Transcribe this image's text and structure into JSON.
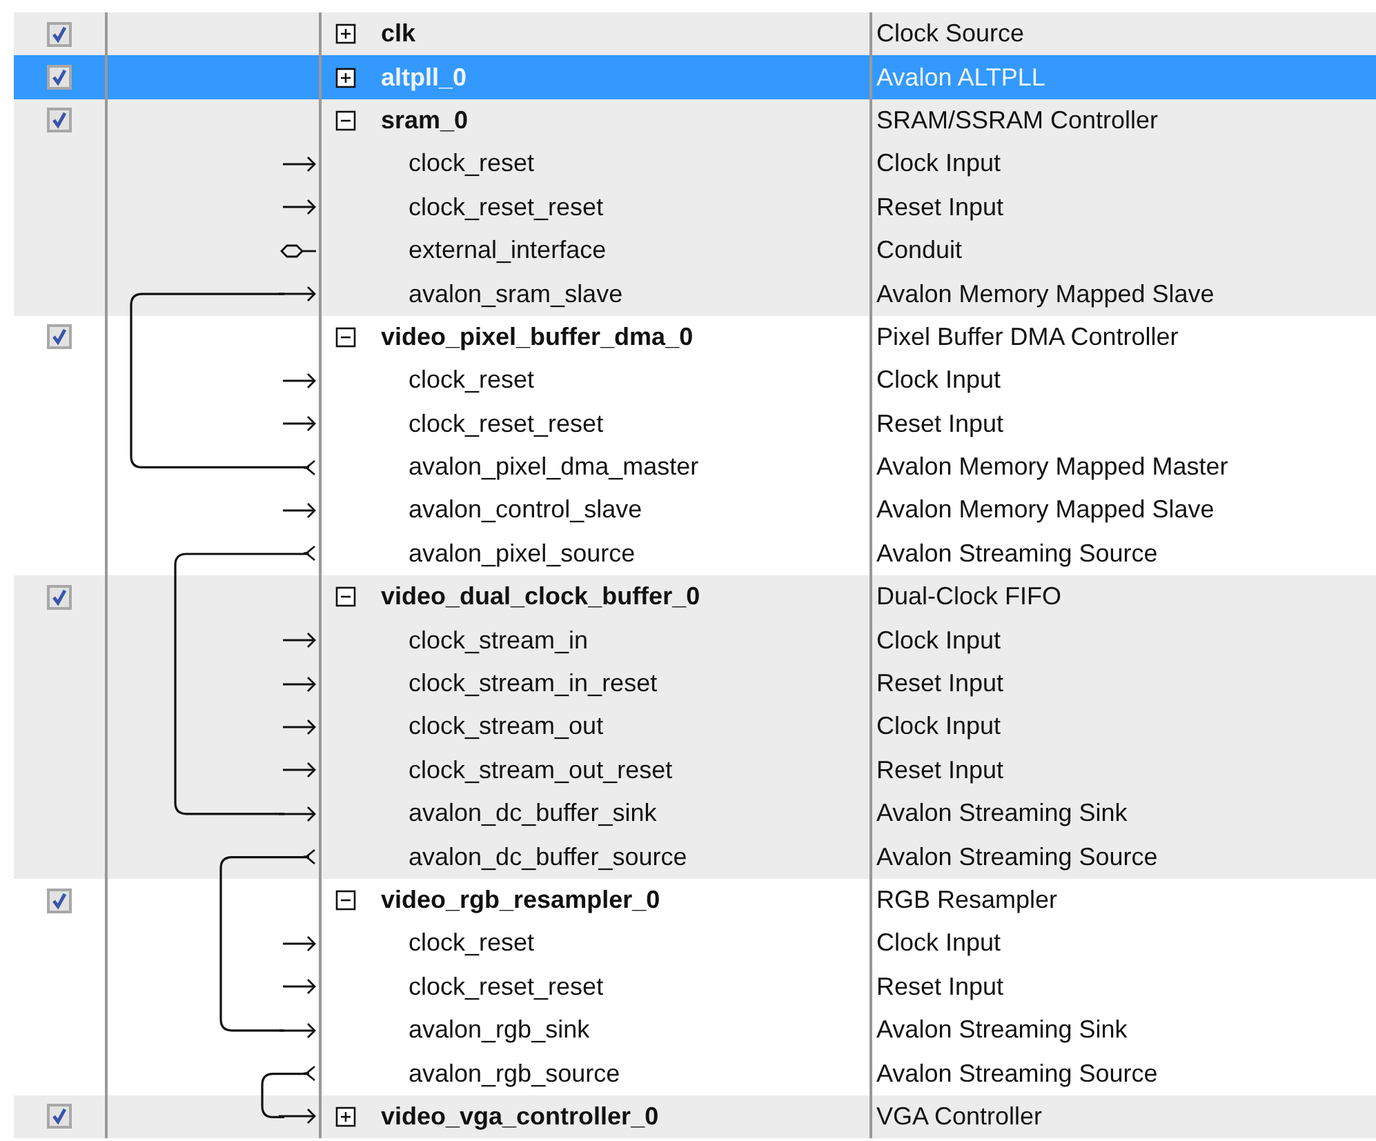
{
  "modules": [
    {
      "name": "clk",
      "description": "Clock Source",
      "checked": true,
      "expanded": false,
      "selected": false
    },
    {
      "name": "altpll_0",
      "description": "Avalon ALTPLL",
      "checked": true,
      "expanded": false,
      "selected": true
    },
    {
      "name": "sram_0",
      "description": "SRAM/SSRAM Controller",
      "checked": true,
      "expanded": true,
      "selected": false,
      "children": [
        {
          "name": "clock_reset",
          "description": "Clock Input",
          "kind": "in",
          "connected": false
        },
        {
          "name": "clock_reset_reset",
          "description": "Reset Input",
          "kind": "in",
          "connected": false
        },
        {
          "name": "external_interface",
          "description": "Conduit",
          "kind": "conduit",
          "connected": false
        },
        {
          "name": "avalon_sram_slave",
          "description": "Avalon Memory Mapped Slave",
          "kind": "in",
          "connected": true
        }
      ]
    },
    {
      "name": "video_pixel_buffer_dma_0",
      "description": "Pixel Buffer DMA Controller",
      "checked": true,
      "expanded": true,
      "selected": false,
      "children": [
        {
          "name": "clock_reset",
          "description": "Clock Input",
          "kind": "in",
          "connected": false
        },
        {
          "name": "clock_reset_reset",
          "description": "Reset Input",
          "kind": "in",
          "connected": false
        },
        {
          "name": "avalon_pixel_dma_master",
          "description": "Avalon Memory Mapped Master",
          "kind": "out",
          "connected": true
        },
        {
          "name": "avalon_control_slave",
          "description": "Avalon Memory Mapped Slave",
          "kind": "in",
          "connected": false
        },
        {
          "name": "avalon_pixel_source",
          "description": "Avalon Streaming Source",
          "kind": "out",
          "connected": true
        }
      ]
    },
    {
      "name": "video_dual_clock_buffer_0",
      "description": "Dual-Clock FIFO",
      "checked": true,
      "expanded": true,
      "selected": false,
      "children": [
        {
          "name": "clock_stream_in",
          "description": "Clock Input",
          "kind": "in",
          "connected": false
        },
        {
          "name": "clock_stream_in_reset",
          "description": "Reset Input",
          "kind": "in",
          "connected": false
        },
        {
          "name": "clock_stream_out",
          "description": "Clock Input",
          "kind": "in",
          "connected": false
        },
        {
          "name": "clock_stream_out_reset",
          "description": "Reset Input",
          "kind": "in",
          "connected": false
        },
        {
          "name": "avalon_dc_buffer_sink",
          "description": "Avalon Streaming Sink",
          "kind": "in",
          "connected": true
        },
        {
          "name": "avalon_dc_buffer_source",
          "description": "Avalon Streaming Source",
          "kind": "out",
          "connected": true
        }
      ]
    },
    {
      "name": "video_rgb_resampler_0",
      "description": "RGB Resampler",
      "checked": true,
      "expanded": true,
      "selected": false,
      "children": [
        {
          "name": "clock_reset",
          "description": "Clock Input",
          "kind": "in",
          "connected": false
        },
        {
          "name": "clock_reset_reset",
          "description": "Reset Input",
          "kind": "in",
          "connected": false
        },
        {
          "name": "avalon_rgb_sink",
          "description": "Avalon Streaming Sink",
          "kind": "in",
          "connected": true
        },
        {
          "name": "avalon_rgb_source",
          "description": "Avalon Streaming Source",
          "kind": "out",
          "connected": true
        }
      ]
    },
    {
      "name": "video_vga_controller_0",
      "description": "VGA Controller",
      "checked": true,
      "expanded": false,
      "selected": false,
      "kind": "in",
      "connected": true
    }
  ]
}
